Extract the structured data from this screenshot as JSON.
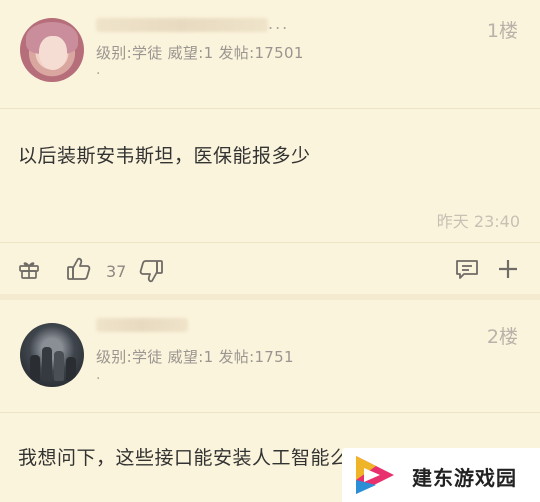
{
  "posts": [
    {
      "floor": "1楼",
      "meta": "级别:学徒 威望:1 发帖:17501",
      "content": "以后装斯安韦斯坦，医保能报多少",
      "time": "昨天 23:40",
      "like_count": "37",
      "avatar_icon": "user-avatar-icon"
    },
    {
      "floor": "2楼",
      "meta": "级别:学徒 威望:1 发帖:1751",
      "content": "我想问下，这些接口能安装人工智能么?",
      "avatar_icon": "user-avatar-icon"
    }
  ],
  "name_ellipsis": "...",
  "small_dot": ".",
  "watermark": {
    "text": "建东游戏园",
    "logo_icon": "play-triangle-logo-icon",
    "colors": [
      "#e8306f",
      "#2a8fd6",
      "#f0b428"
    ]
  },
  "colors": {
    "background": "#fbf4dc",
    "separator": "#f3ead0"
  }
}
